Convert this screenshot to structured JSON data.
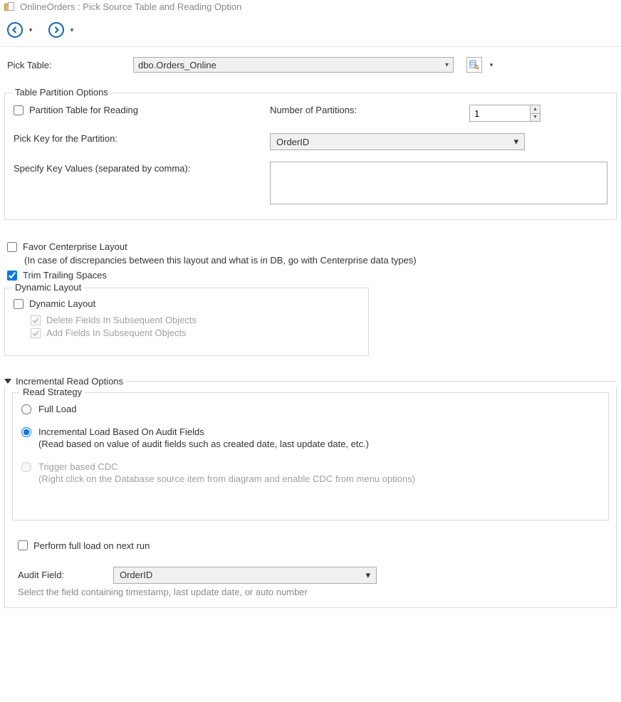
{
  "window": {
    "title": "OnlineOrders : Pick Source Table and Reading Option"
  },
  "pick_table": {
    "label": "Pick Table:",
    "value": "dbo.Orders_Online"
  },
  "partition": {
    "legend": "Table Partition Options",
    "partition_table_label": "Partition Table for Reading",
    "num_partitions_label": "Number of Partitions:",
    "num_partitions_value": "1",
    "pick_key_label": "Pick Key for the Partition:",
    "pick_key_value": "OrderID",
    "specify_values_label": "Specify Key Values (separated by comma):"
  },
  "favor": {
    "label": "Favor Centerprise Layout",
    "hint": "(In case of discrepancies between this layout and what is in DB, go with Centerprise data types)"
  },
  "trim": {
    "label": "Trim Trailing Spaces"
  },
  "dynamic": {
    "legend": "Dynamic Layout",
    "cb_label": "Dynamic Layout",
    "delete_label": "Delete Fields In Subsequent Objects",
    "add_label": "Add Fields In Subsequent Objects"
  },
  "incremental": {
    "header": "Incremental Read Options",
    "read_strategy_legend": "Read Strategy",
    "full_load_label": "Full Load",
    "incr_label": "Incremental Load Based On Audit Fields",
    "incr_desc": "(Read based on value of audit fields such as created date, last update date, etc.)",
    "cdc_label": "Trigger based CDC",
    "cdc_desc": "(Right click on the Database source item from diagram and enable CDC from menu options)",
    "perform_full_label": "Perform full load on next run",
    "audit_field_label": "Audit Field:",
    "audit_field_value": "OrderID",
    "audit_hint": "Select the field containing timestamp, last update date, or auto number"
  }
}
